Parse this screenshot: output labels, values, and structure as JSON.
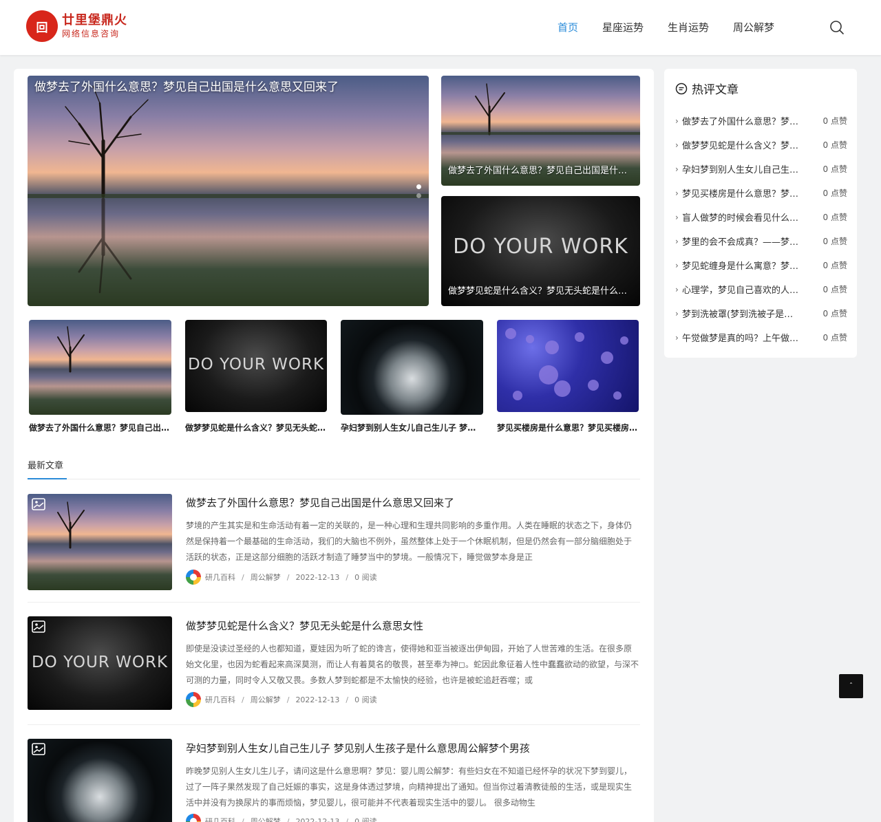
{
  "header": {
    "logo_mark": "回",
    "logo_line1": "廿里堡鼎火",
    "logo_line2": "网络信息咨询",
    "nav": [
      "首页",
      "星座运势",
      "生肖运势",
      "周公解梦"
    ],
    "active_nav": "首页"
  },
  "slider": {
    "main_caption": "做梦去了外国什么意思？梦见自己出国是什么意思又回来了",
    "side_top_caption": "做梦去了外国什么意思？梦见自己出国是什么意思又回来了",
    "side_bottom_caption": "做梦梦见蛇是什么含义？梦见无头蛇是什么意思女性",
    "image_text": "DO YOUR WORK"
  },
  "thumbs": [
    "做梦去了外国什么意思？梦见自己出国是什么意思又回来了",
    "做梦梦见蛇是什么含义？梦见无头蛇是什么意思女性",
    "孕妇梦到别人生女儿自己生儿子 梦见别人生孩子是什么意思",
    "梦见买楼房是什么意思？梦见买楼房子是什么意思"
  ],
  "latest": {
    "title": "最新文章",
    "posts": [
      {
        "title": "做梦去了外国什么意思？梦见自己出国是什么意思又回来了",
        "desc": "梦境的产生其实是和生命活动有着一定的关联的，是一种心理和生理共同影响的多重作用。人类在睡眠的状态之下，身体仍然是保持着一个最基础的生命活动，我们的大脑也不例外，虽然整体上处于一个休眠机制，但是仍然会有一部分脑细胞处于活跃的状态，正是这部分细胞的活跃才制造了睡梦当中的梦境。一般情况下，睡觉做梦本身是正",
        "author": "研几百科",
        "category": "周公解梦",
        "date": "2022-12-13",
        "reads": "0 阅读"
      },
      {
        "title": "做梦梦见蛇是什么含义？梦见无头蛇是什么意思女性",
        "desc": "即使是没读过圣经的人也都知道，夏娃因为听了蛇的谗言，使得她和亚当被逐出伊甸园，开始了人世苦难的生活。在很多原始文化里，也因为蛇看起来高深莫测，而让人有着莫名的敬畏，甚至奉为神◻。蛇因此象征着人性中蠢蠢欲动的欲望，与深不可测的力量，同时令人又敬又畏。多数人梦到蛇都是不太愉快的经验，也许是被蛇追赶吞噬；或",
        "author": "研几百科",
        "category": "周公解梦",
        "date": "2022-12-13",
        "reads": "0 阅读"
      },
      {
        "title": "孕妇梦到别人生女儿自己生儿子 梦见别人生孩子是什么意思周公解梦个男孩",
        "desc": "昨晚梦见别人生女儿生儿子，请问这是什么意思啊？梦见：婴儿周公解梦：有些妇女在不知道已经怀孕的状况下梦到婴儿，过了一阵子果然发现了自己妊娠的事实，这是身体透过梦境，向精神提出了通知。但当你过着清教徒般的生活，或是现实生活中并没有为换尿片的事而烦恼，梦见婴儿，很可能并不代表着现实生活中的婴儿。 很多动物生",
        "author": "研几百科",
        "category": "周公解梦",
        "date": "2022-12-13",
        "reads": "0 阅读"
      }
    ]
  },
  "sidebar": {
    "title": "热评文章",
    "items": [
      {
        "title": "做梦去了外国什么意思？梦见自己出国是什么意思又回来了",
        "likes": "0 点赞"
      },
      {
        "title": "做梦梦见蛇是什么含义？梦见无头蛇是什么意思女性",
        "likes": "0 点赞"
      },
      {
        "title": "孕妇梦到别人生女儿自己生儿子 梦见别人生孩子是什么意思",
        "likes": "0 点赞"
      },
      {
        "title": "梦见买楼房是什么意思？梦见买楼房子是什么意思",
        "likes": "0 点赞"
      },
      {
        "title": "盲人做梦的时候会看见什么？盲人的梦",
        "likes": "0 点赞"
      },
      {
        "title": "梦里的会不会成真？——梦的解析",
        "likes": "0 点赞"
      },
      {
        "title": "梦见蛇缠身是什么寓意？梦见蛇缠身",
        "likes": "0 点赞"
      },
      {
        "title": "心理学，梦见自己喜欢的人是什么意思",
        "likes": "0 点赞"
      },
      {
        "title": "梦到洗被罩(梦到洗被子是什么意思)",
        "likes": "0 点赞"
      },
      {
        "title": "午觉做梦是真的吗？上午做的梦准吗",
        "likes": "0 点赞"
      }
    ]
  },
  "back_to_top": "ˆ"
}
